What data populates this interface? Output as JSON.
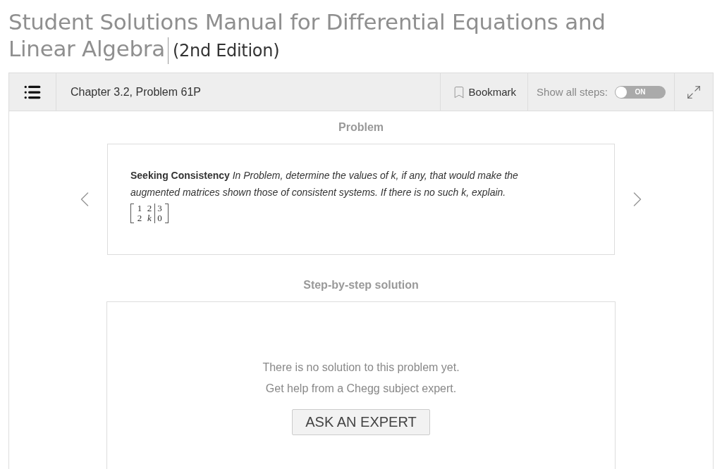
{
  "book": {
    "title": "Student Solutions Manual for Differential Equations and Linear Algebra",
    "edition": "(2nd Edition)"
  },
  "toolbar": {
    "chapter": "Chapter 3.2, Problem 61P",
    "bookmark": "Bookmark",
    "steps_label": "Show all steps:",
    "toggle": {
      "on": true,
      "label": "ON"
    }
  },
  "problem": {
    "heading": "Problem",
    "text": "**Seeking Consistency** *In Problem, determine the values of k, if any, that would make the augmented matrices shown those of consistent systems. If there is no such k, explain.*",
    "matrix": [
      [
        "1",
        "2",
        "3"
      ],
      [
        "2",
        "k",
        "0"
      ]
    ]
  },
  "solution": {
    "heading": "Step-by-step solution",
    "message": "There is no solution to this problem yet.",
    "help": "Get help from a Chegg subject expert.",
    "button": "ASK AN EXPERT"
  }
}
